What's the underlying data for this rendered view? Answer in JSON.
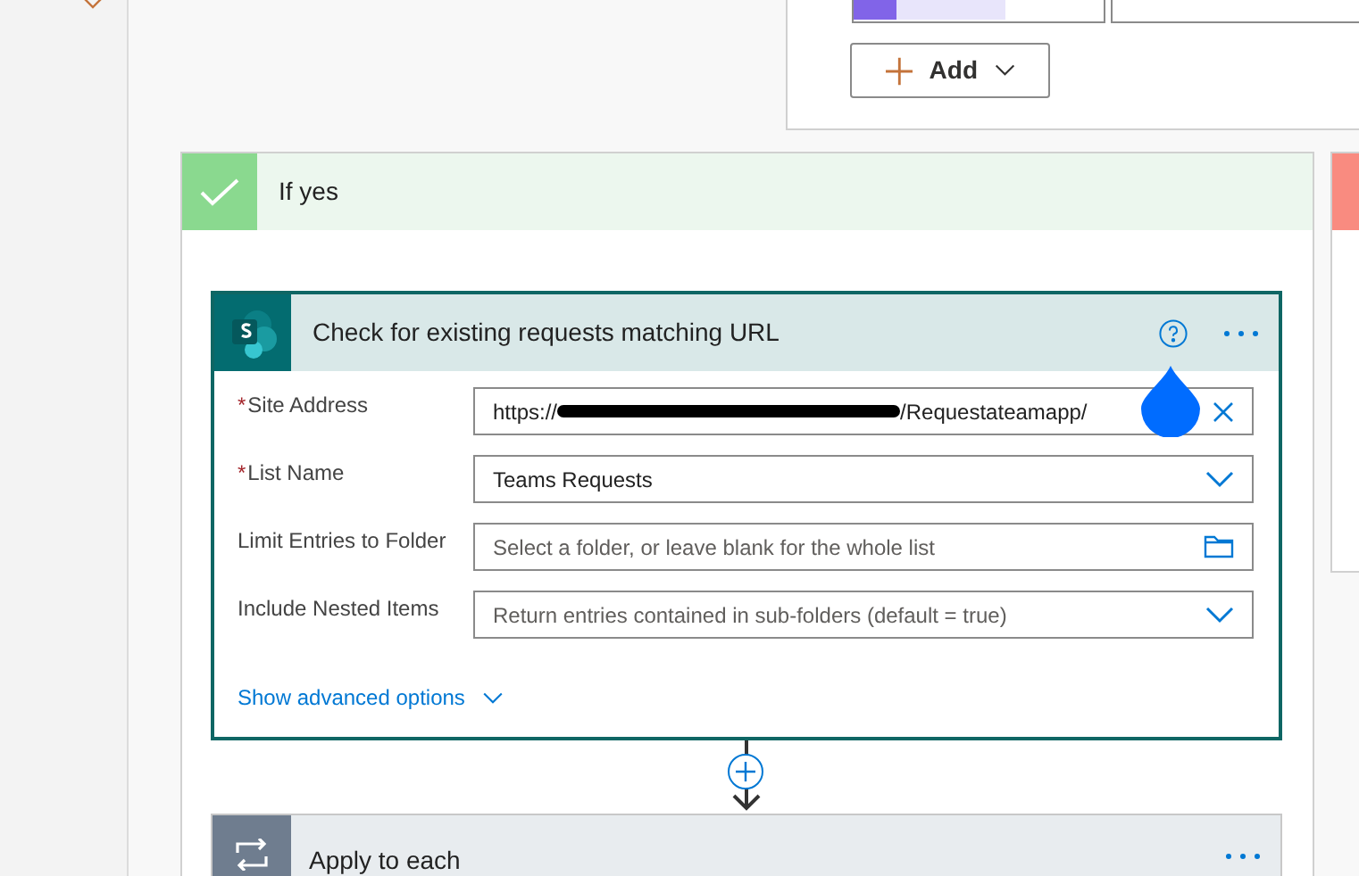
{
  "condition_panel": {
    "add_button": "Add"
  },
  "branch": {
    "title": "If yes"
  },
  "action": {
    "title": "Check for existing requests matching URL",
    "fields": [
      {
        "kind": "clearable",
        "required_mark": "*",
        "label": "Site Address",
        "value_start": "https://",
        "value_end": "/Requestateamapp/"
      },
      {
        "kind": "dropdown",
        "required_mark": "*",
        "label": "List Name",
        "value": "Teams Requests"
      },
      {
        "kind": "folder",
        "label": "Limit Entries to Folder",
        "placeholder": "Select a folder, or leave blank for the whole list"
      },
      {
        "kind": "dropdown",
        "label": "Include Nested Items",
        "placeholder": "Return entries contained in sub-folders (default = true)"
      }
    ],
    "advanced_link": "Show advanced options"
  },
  "next_action": {
    "title": "Apply to each"
  }
}
